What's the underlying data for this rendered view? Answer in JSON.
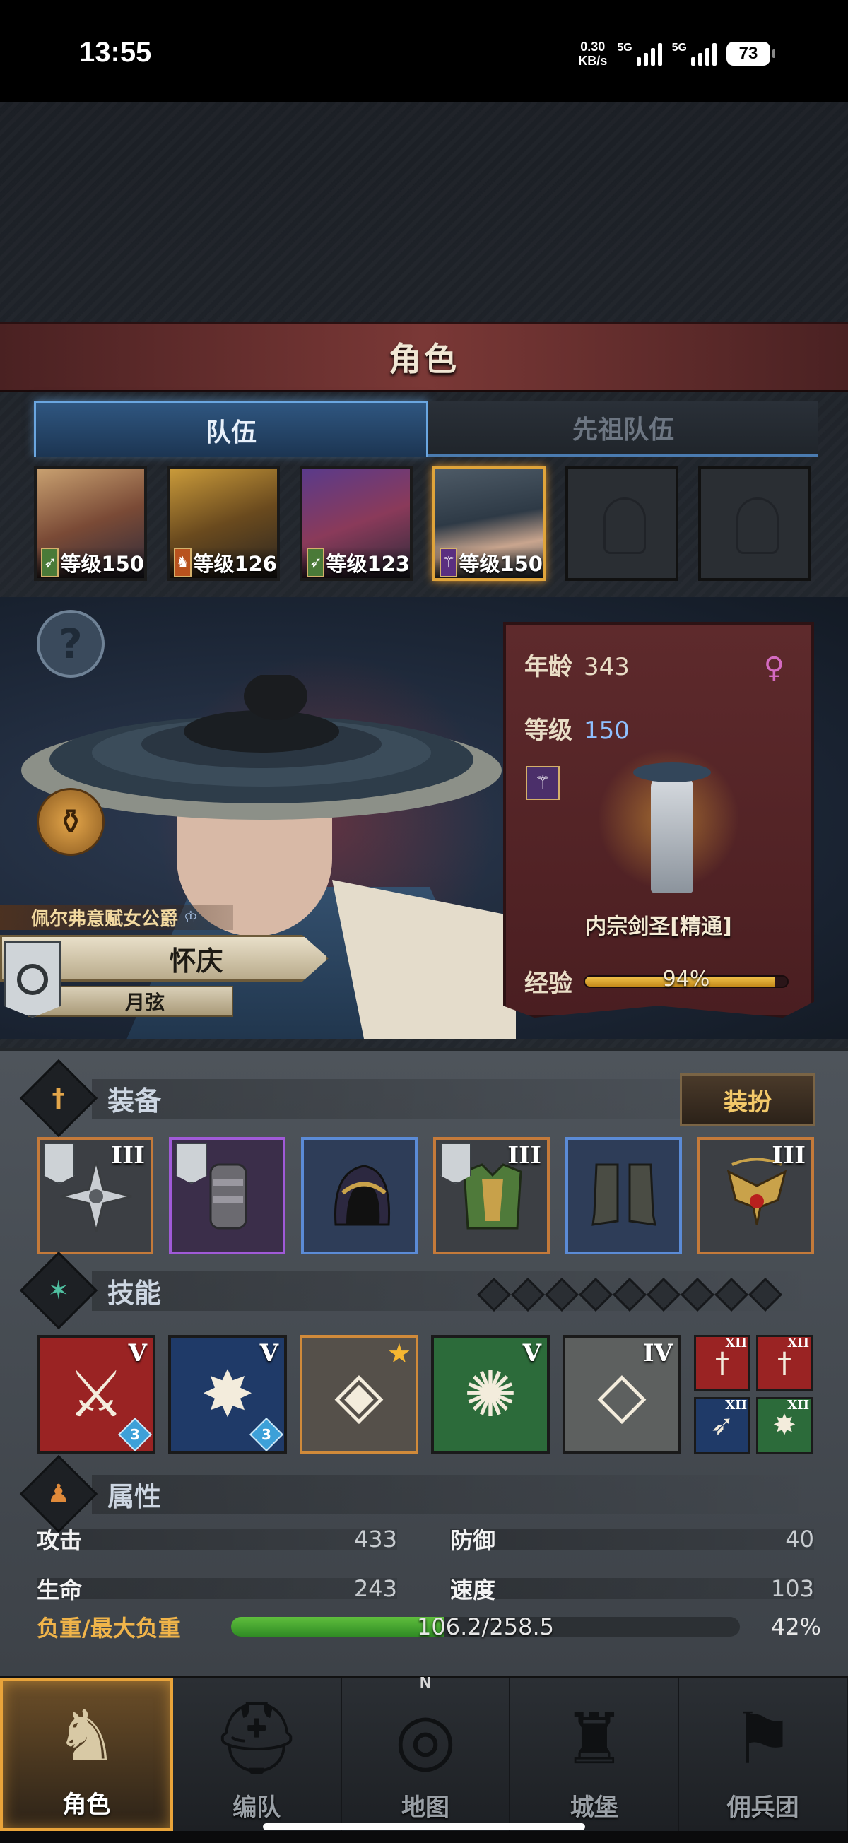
{
  "status_bar": {
    "time": "13:55",
    "speed_value": "0.30",
    "speed_unit": "KB/s",
    "signal1_label": "5G",
    "signal2_label": "5G",
    "battery": "73"
  },
  "screen_title": "角色",
  "tabs": [
    {
      "label": "队伍",
      "active": true
    },
    {
      "label": "先祖队伍",
      "active": false
    }
  ],
  "team": [
    {
      "level": "等级150",
      "class_icon": "bow-icon",
      "selected": false
    },
    {
      "level": "等级126",
      "class_icon": "beast-icon",
      "selected": false
    },
    {
      "level": "等级123",
      "class_icon": "bow-icon",
      "selected": false
    },
    {
      "level": "等级150",
      "class_icon": "staff-icon",
      "selected": true
    }
  ],
  "character": {
    "title": "佩尔弗意赋女公爵",
    "name": "怀庆",
    "subtitle": "月弦",
    "age_label": "年龄",
    "age": "343",
    "level_label": "等级",
    "level": "150",
    "job": "内宗剑圣[精通]",
    "exp_label": "经验",
    "exp_percent": "94%",
    "exp_fraction": 0.94
  },
  "equipment": {
    "title": "装备",
    "dress_button": "装扮",
    "items": [
      {
        "name": "cross-weapon",
        "rarity": "orange",
        "tier": "III",
        "guild": true
      },
      {
        "name": "gauntlet",
        "rarity": "purple",
        "tier": "",
        "guild": true
      },
      {
        "name": "hood",
        "rarity": "blue",
        "tier": "",
        "guild": false
      },
      {
        "name": "armor",
        "rarity": "orange",
        "tier": "III",
        "guild": true
      },
      {
        "name": "boots",
        "rarity": "blue",
        "tier": "",
        "guild": false
      },
      {
        "name": "bat-amulet",
        "rarity": "orange",
        "tier": "III",
        "guild": false
      }
    ]
  },
  "skills": {
    "title": "技能",
    "dots": 9,
    "items": [
      {
        "color": "red",
        "tier": "V",
        "gem": "3",
        "glyph": "⚔"
      },
      {
        "color": "navy",
        "tier": "V",
        "gem": "3",
        "glyph": "✸"
      },
      {
        "color": "grey",
        "tier": "",
        "gem": "",
        "glyph": "◈",
        "star": true
      },
      {
        "color": "green",
        "tier": "V",
        "gem": "",
        "glyph": "✺"
      },
      {
        "color": "stone",
        "tier": "IV",
        "gem": "",
        "glyph": "◇"
      }
    ],
    "mini": [
      {
        "color": "red",
        "tier": "XII",
        "glyph": "†"
      },
      {
        "color": "red",
        "tier": "XII",
        "glyph": "†"
      },
      {
        "color": "navy",
        "tier": "XII",
        "glyph": "➶"
      },
      {
        "color": "green",
        "tier": "XII",
        "glyph": "✸"
      }
    ]
  },
  "attributes": {
    "title": "属性",
    "attack_label": "攻击",
    "attack": "433",
    "defense_label": "防御",
    "defense": "40",
    "hp_label": "生命",
    "hp": "243",
    "speed_label": "速度",
    "speed": "103",
    "load_label": "负重/最大负重",
    "load_value": "106.2/258.5",
    "load_percent": "42%",
    "load_fraction": 0.42
  },
  "nav": [
    {
      "label": "角色",
      "active": true
    },
    {
      "label": "编队",
      "active": false
    },
    {
      "label": "地图",
      "active": false,
      "compass": "N"
    },
    {
      "label": "城堡",
      "active": false
    },
    {
      "label": "佣兵团",
      "active": false
    }
  ]
}
